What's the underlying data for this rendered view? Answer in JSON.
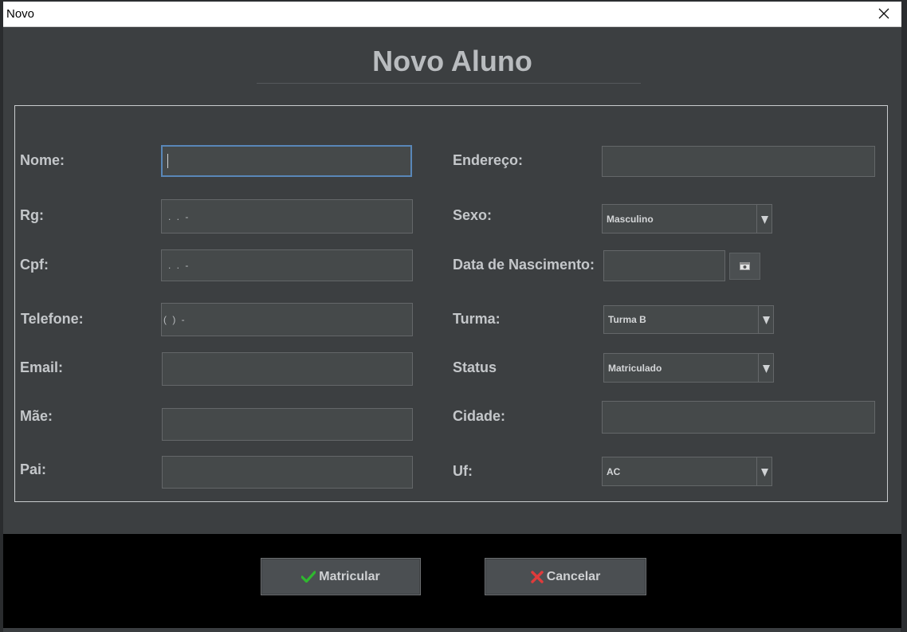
{
  "window": {
    "title": "Novo"
  },
  "heading": "Novo Aluno",
  "left_fields": [
    {
      "label": "Nome:",
      "value": "",
      "mask": ""
    },
    {
      "label": "Rg:",
      "value": "",
      "mask": ". . -"
    },
    {
      "label": "Cpf:",
      "value": "",
      "mask": ". . -"
    },
    {
      "label": "Telefone:",
      "value": "",
      "mask": "( )   -"
    },
    {
      "label": "Email:",
      "value": "",
      "mask": ""
    },
    {
      "label": "Mãe:",
      "value": "",
      "mask": ""
    },
    {
      "label": "Pai:",
      "value": "",
      "mask": ""
    }
  ],
  "right_fields": {
    "endereco": {
      "label": "Endereço:",
      "value": ""
    },
    "sexo": {
      "label": "Sexo:",
      "selected": "Masculino"
    },
    "data_nascimento": {
      "label": "Data de Nascimento:",
      "value": ""
    },
    "turma": {
      "label": "Turma:",
      "selected": "Turma B"
    },
    "status": {
      "label": "Status",
      "selected": "Matriculado"
    },
    "cidade": {
      "label": "Cidade:",
      "value": ""
    },
    "uf": {
      "label": "Uf:",
      "selected": "AC"
    }
  },
  "buttons": {
    "matricular": "Matricular",
    "cancelar": "Cancelar"
  },
  "icons": {
    "matricular": "checkmark-icon",
    "cancelar": "cross-icon",
    "calendar": "calendar-icon",
    "dropdown": "dropdown-arrow-icon",
    "close": "close-icon"
  },
  "colors": {
    "dialog_bg": "#3c3f41",
    "field_bg": "#45494a",
    "focus_border": "#5987b8",
    "check_green": "#2fb82f",
    "cross_red": "#e03b3b"
  }
}
